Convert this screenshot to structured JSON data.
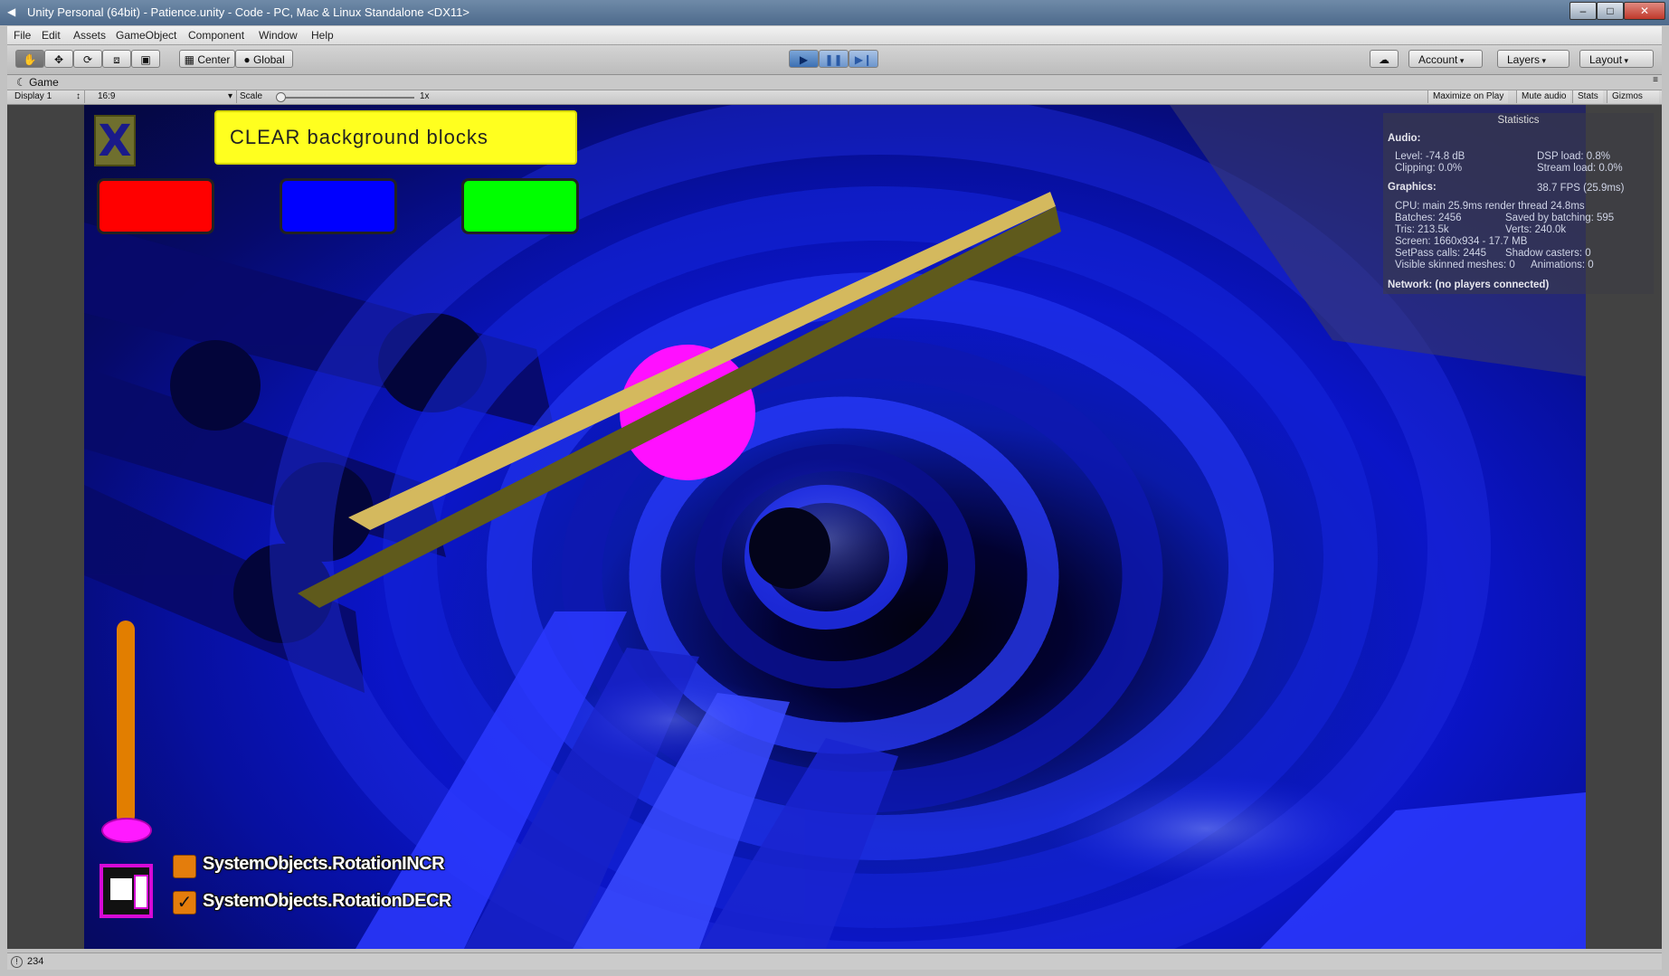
{
  "window": {
    "title": "Unity Personal (64bit) - Patience.unity - Code - PC, Mac & Linux Standalone <DX11>",
    "minimize": "–",
    "maximize": "□",
    "close": "✕"
  },
  "menu": [
    "File",
    "Edit",
    "Assets",
    "GameObject",
    "Component",
    "Window",
    "Help"
  ],
  "toolbar": {
    "pivot": "Center",
    "space": "Global",
    "account": "Account",
    "layers": "Layers",
    "layout": "Layout"
  },
  "game_tab": {
    "label": "Game",
    "display": "Display 1",
    "aspect": "16:9",
    "scale_label": "Scale",
    "scale_value": "1x",
    "maximize_on_play": "Maximize on Play",
    "mute_audio": "Mute audio",
    "stats": "Stats",
    "gizmos": "Gizmos"
  },
  "game_ui": {
    "x_button": "X",
    "clear_button": "CLEAR background blocks",
    "color_buttons": [
      "#ff0000",
      "#0000ff",
      "#00ff00"
    ],
    "toggles": [
      {
        "label": "SystemObjects.RotationINCR",
        "checked": false
      },
      {
        "label": "SystemObjects.RotationDECR",
        "checked": true
      }
    ]
  },
  "statistics": {
    "title": "Statistics",
    "audio_header": "Audio:",
    "level": "Level: -74.8 dB",
    "dsp_load": "DSP load: 0.8%",
    "clipping": "Clipping: 0.0%",
    "stream_load": "Stream load: 0.0%",
    "graphics_header": "Graphics:",
    "fps": "38.7 FPS (25.9ms)",
    "cpu": "CPU: main 25.9ms  render thread 24.8ms",
    "batches": "Batches: 2456",
    "saved_batching": "Saved by batching: 595",
    "tris": "Tris: 213.5k",
    "verts": "Verts: 240.0k",
    "screen": "Screen: 1660x934 - 17.7 MB",
    "setpass": "SetPass calls: 2445",
    "shadow_casters": "Shadow casters: 0",
    "skinned": "Visible skinned meshes: 0",
    "animations": "Animations: 0",
    "network": "Network: (no players connected)"
  },
  "status": {
    "text": "234"
  }
}
